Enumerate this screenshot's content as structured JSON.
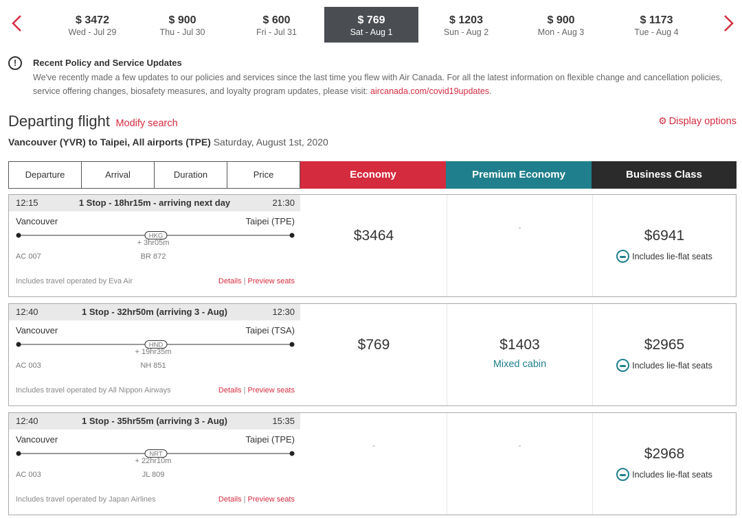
{
  "date_bar": {
    "dates": [
      {
        "price": "$ 3472",
        "day": "Wed - Jul 29",
        "active": false
      },
      {
        "price": "$ 900",
        "day": "Thu - Jul 30",
        "active": false
      },
      {
        "price": "$ 600",
        "day": "Fri - Jul 31",
        "active": false
      },
      {
        "price": "$ 769",
        "day": "Sat - Aug 1",
        "active": true
      },
      {
        "price": "$ 1203",
        "day": "Sun - Aug 2",
        "active": false
      },
      {
        "price": "$ 900",
        "day": "Mon - Aug 3",
        "active": false
      },
      {
        "price": "$ 1173",
        "day": "Tue - Aug 4",
        "active": false
      }
    ]
  },
  "notice": {
    "icon": "!",
    "title": "Recent Policy and Service Updates",
    "body": "We've recently made a few updates to our policies and services since the last time you flew with Air Canada. For all the latest information on flexible change and cancellation policies, service offering changes, biosafety measures, and loyalty program updates, please visit: ",
    "link": "aircanada.com/covid19updates",
    "end": "."
  },
  "heading": {
    "title": "Departing flight",
    "modify": "Modify search",
    "display_options": "Display options",
    "gear_glyph": "⚙",
    "route": "Vancouver (YVR) to Taipei, All airports (TPE)",
    "date": "Saturday, August 1st, 2020"
  },
  "columns": {
    "sort": [
      "Departure",
      "Arrival",
      "Duration",
      "Price"
    ],
    "economy": "Economy",
    "premium": "Premium Economy",
    "business": "Business Class"
  },
  "colors": {
    "economy": "#d52b3e",
    "premium": "#1f7f8c",
    "business": "#2b2b2b",
    "accent": "#d52b3e"
  },
  "flights": [
    {
      "dep": "12:15",
      "stops": "1 Stop - 18hr15m - arriving next day",
      "arr": "21:30",
      "from": "Vancouver",
      "to": "Taipei (TPE)",
      "via": "HKG",
      "layover": "+ 3hr05m",
      "flight_a": "AC 007",
      "flight_b": "BR 872",
      "operated": "Includes travel operated by Eva Air",
      "details": "Details",
      "sep": "|",
      "preview": "Preview seats",
      "economy": "$3464",
      "premium": "-",
      "premium_note": "",
      "business": "$6941",
      "business_note": "Includes lie-flat seats"
    },
    {
      "dep": "12:40",
      "stops": "1 Stop - 32hr50m (arriving 3 - Aug)",
      "arr": "12:30",
      "from": "Vancouver",
      "to": "Taipei (TSA)",
      "via": "HND",
      "layover": "+ 19hr35m",
      "flight_a": "AC 003",
      "flight_b": "NH 851",
      "operated": "Includes travel operated by All Nippon Airways",
      "details": "Details",
      "sep": "|",
      "preview": "Preview seats",
      "economy": "$769",
      "premium": "$1403",
      "premium_note": "Mixed cabin",
      "business": "$2965",
      "business_note": "Includes lie-flat seats"
    },
    {
      "dep": "12:40",
      "stops": "1 Stop - 35hr55m (arriving 3 - Aug)",
      "arr": "15:35",
      "from": "Vancouver",
      "to": "Taipei (TPE)",
      "via": "NRT",
      "layover": "+ 22hr10m",
      "flight_a": "AC 003",
      "flight_b": "JL 809",
      "operated": "Includes travel operated by Japan Airlines",
      "details": "Details",
      "sep": "|",
      "preview": "Preview seats",
      "economy": "-",
      "premium": "-",
      "premium_note": "",
      "business": "$2968",
      "business_note": "Includes lie-flat seats"
    }
  ]
}
